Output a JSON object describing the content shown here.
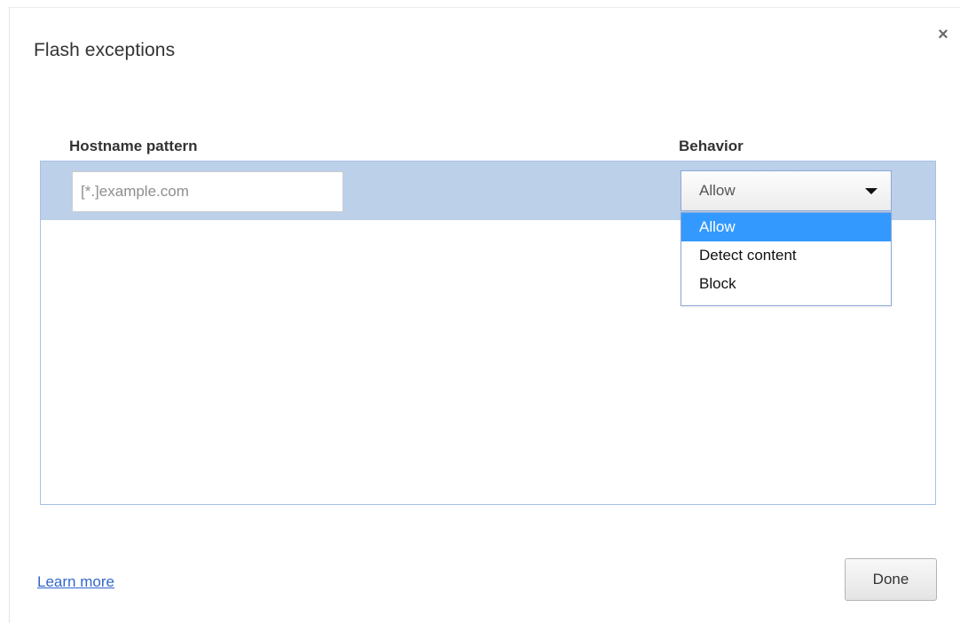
{
  "dialog": {
    "title": "Flash exceptions",
    "close_label": "×"
  },
  "columns": {
    "hostname_header": "Hostname pattern",
    "behavior_header": "Behavior"
  },
  "new_row": {
    "hostname_value": "",
    "hostname_placeholder": "[*.]example.com",
    "behavior_selected": "Allow",
    "dropdown_open": true
  },
  "behavior_options": [
    {
      "label": "Allow",
      "highlighted": true
    },
    {
      "label": "Detect content",
      "highlighted": false
    },
    {
      "label": "Block",
      "highlighted": false
    }
  ],
  "footer": {
    "learn_more": "Learn more",
    "done_label": "Done"
  },
  "colors": {
    "selected_row": "#bcd0ea",
    "highlight": "#3399ff",
    "link": "#3366cc",
    "list_border": "#a8c0e8"
  },
  "icons": {
    "close": "close-icon",
    "select_arrow": "triangle-down-icon"
  }
}
